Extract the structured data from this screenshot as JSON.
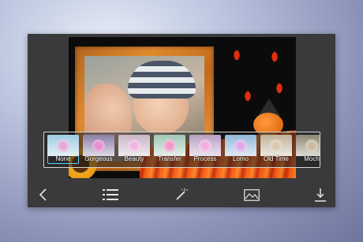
{
  "filters": [
    {
      "label": "None",
      "tint": "#9fcbe0",
      "flower": "#e9a7d8"
    },
    {
      "label": "Gorgeous",
      "tint": "#8a7fa6",
      "flower": "#e58ed1"
    },
    {
      "label": "Beauty",
      "tint": "#c9b6c8",
      "flower": "#f0b6e2"
    },
    {
      "label": "Transfer",
      "tint": "#a2c7b4",
      "flower": "#f19ac9"
    },
    {
      "label": "Process",
      "tint": "#b8a0c4",
      "flower": "#f4aee0"
    },
    {
      "label": "Lomo",
      "tint": "#92b8d9",
      "flower": "#e0a8e8"
    },
    {
      "label": "Old Time",
      "tint": "#bfb299",
      "flower": "#d9c9b0"
    },
    {
      "label": "Moch",
      "tint": "#8e8674",
      "flower": "#c9bca3"
    }
  ],
  "selected_filter": "None",
  "toolbar": {
    "back": "back-chevron-icon",
    "menu": "list-icon",
    "effects": "magic-wand-icon",
    "gallery": "image-icon",
    "download": "download-icon"
  },
  "colors": {
    "panel": "#3a3a3c",
    "selection": "#5fd1ff"
  }
}
